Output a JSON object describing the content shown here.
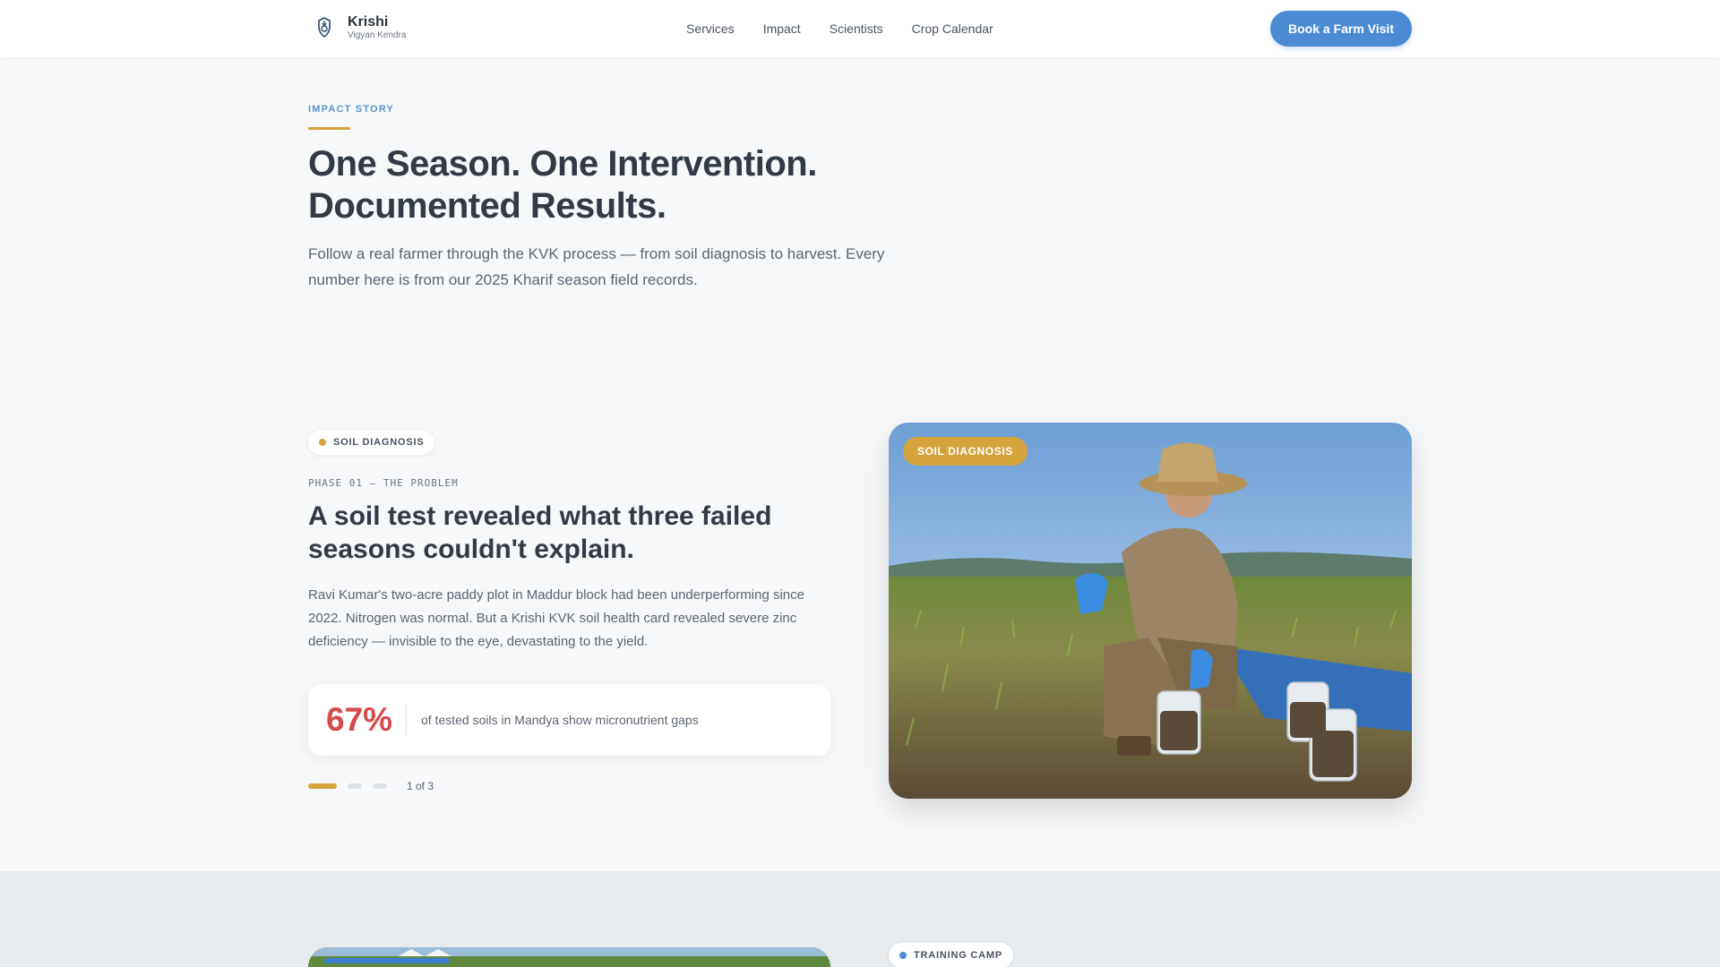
{
  "brand": {
    "name": "Krishi",
    "subtitle": "Vigyan Kendra",
    "icon": "shield-lotus-icon"
  },
  "nav": {
    "items": [
      "Services",
      "Impact",
      "Scientists",
      "Crop Calendar"
    ]
  },
  "cta": {
    "label": "Book a Farm Visit"
  },
  "hero": {
    "eyebrow": "IMPACT STORY",
    "title": "One Season. One Intervention. Documented Results.",
    "subtitle": "Follow a real farmer through the KVK process — from soil diagnosis to harvest. Every number here is from our 2025 Kharif season field records."
  },
  "story": {
    "pill": "SOIL DIAGNOSIS",
    "phase": "PHASE 01 — THE PROBLEM",
    "title": "A soil test revealed what three failed seasons couldn't explain.",
    "body": "Ravi Kumar's two-acre paddy plot in Maddur block had been underperforming since 2022. Nitrogen was normal. But a Krishi KVK soil health card revealed severe zinc deficiency — invisible to the eye, devastating to the yield.",
    "stat": {
      "value": "67%",
      "text": "of tested soils in Mandya show micronutrient gaps"
    },
    "progress": {
      "current": 1,
      "total": 3,
      "label": "1 of 3"
    },
    "image_badge": "SOIL DIAGNOSIS"
  },
  "next": {
    "pill": "TRAINING CAMP"
  },
  "colors": {
    "accent": "#4a8bd4",
    "gold": "#d6a43c",
    "stat_red": "#d54a4a",
    "eyebrow_blue": "#5b93c9"
  }
}
